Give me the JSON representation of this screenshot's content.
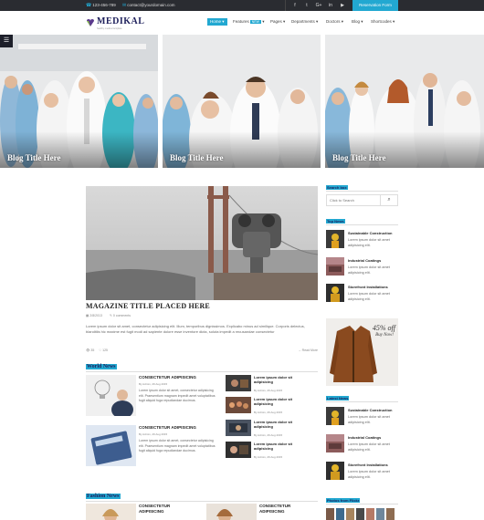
{
  "topbar": {
    "phone": "123-456-789",
    "email": "contact@yourdomain.com",
    "social": [
      "f",
      "t",
      "G+",
      "in",
      "▶"
    ],
    "reserve": "Reservation Form"
  },
  "header": {
    "logo": "MEDIKAL",
    "tagline": "healthy medical template",
    "nav": [
      "Home",
      "Features",
      "Pages",
      "Departments",
      "Doctors",
      "Blog",
      "Shortcodes"
    ],
    "features_badge": "NEW"
  },
  "hero": {
    "panels": [
      {
        "title": "Blog Title Here"
      },
      {
        "title": "Blog Title Here"
      },
      {
        "title": "Blog Title Here"
      }
    ],
    "toggle_icon": "☰"
  },
  "main_article": {
    "title": "MAGAZINE TITLE PLACED HERE",
    "date": "2/8/2013",
    "comments": "0 comments",
    "excerpt": "Lorem ipsum dolor sit amet, consectetur adipisicing elit. Illum, temporibus dignissimos. Explicabo minus ad similique. Corporis delectus, blanditiis hic maxime est fugit modi ad sapiente dolore esse inventore dicta, soluta impedit a recusandae consectetur",
    "views": "35",
    "likes": "125",
    "read_more": "→ Read More"
  },
  "world_news": {
    "title": "World News",
    "big_items": [
      {
        "heading": "CONSECTETUR ADIPISICING",
        "meta": "By Admin, 29 Aug 2015",
        "text": "Lorem ipsum dolor sit amet, consectetur adipisicing elit. Praesentium magnam impedit amet voluptatibus fugit aliquid fuga repudiandae ducimus."
      },
      {
        "heading": "CONSECTETUR ADIPISICING",
        "meta": "By Admin, 29 Aug 2015",
        "text": "Lorem ipsum dolor sit amet, consectetur adipisicing elit. Praesentium magnam impedit amet voluptatibus fugit aliquid fuga repudiandae ducimus."
      }
    ],
    "small_items": [
      {
        "title": "Lorem ipsum dolor sit adipisicing",
        "meta": "By Admin, 29 Aug 2015"
      },
      {
        "title": "Lorem ipsum dolor sit adipisicing",
        "meta": "By Admin, 29 Aug 2015"
      },
      {
        "title": "Lorem ipsum dolor sit adipisicing",
        "meta": "By Admin, 29 Aug 2015"
      },
      {
        "title": "Lorem ipsum dolor sit adipisicing",
        "meta": "By Admin, 29 Aug 2015"
      }
    ]
  },
  "fashion_news": {
    "title": "Fashion News",
    "items": [
      {
        "heading": "CONSECTETUR ADIPISICING"
      },
      {
        "heading": "CONSECTETUR ADIPISICING"
      }
    ]
  },
  "sidebar": {
    "search_title": "Search box",
    "search_placeholder": "Click to Search",
    "top_news_title": "Top News",
    "top_news": [
      {
        "heading": "Sustainable Construction",
        "text": "Lorem ipsum dolor sit amet adipisicing elit."
      },
      {
        "heading": "Industrial Coatings",
        "text": "Lorem ipsum dolor sit amet adipisicing elit."
      },
      {
        "heading": "Storefront Installations",
        "text": "Lorem ipsum dolor sit amet adipisicing elit."
      }
    ],
    "ad": {
      "percent": "45% off",
      "buy": "Buy Now!"
    },
    "latest_news_title": "Latest News",
    "latest_news": [
      {
        "heading": "Sustainable Construction",
        "text": "Lorem ipsum dolor sit amet adipisicing elit."
      },
      {
        "heading": "Industrial Coatings",
        "text": "Lorem ipsum dolor sit amet adipisicing elit."
      },
      {
        "heading": "Storefront Installations",
        "text": "Lorem ipsum dolor sit amet adipisicing elit."
      }
    ],
    "photos_title": "Photos from Flickr"
  },
  "colors": {
    "accent": "#22a8d1",
    "topbar": "#2a2c31",
    "brand": "#1d1f5b"
  }
}
